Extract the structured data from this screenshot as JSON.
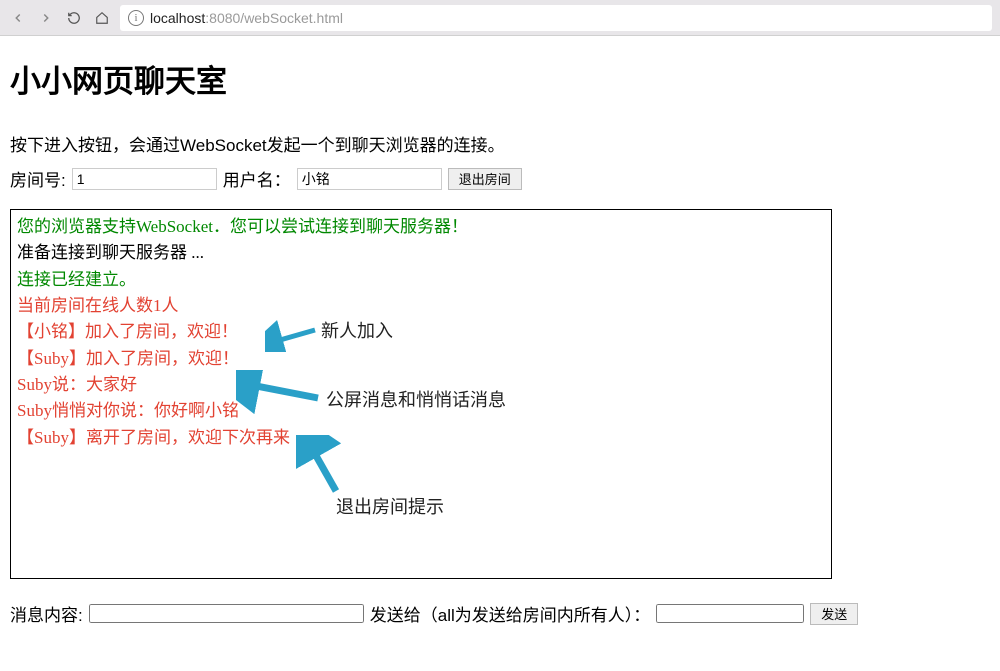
{
  "browser": {
    "url_host": "localhost",
    "url_port_path": ":8080/webSocket.html"
  },
  "page": {
    "title": "小小网页聊天室",
    "description": "按下进入按钮，会通过WebSocket发起一个到聊天浏览器的连接。"
  },
  "form": {
    "room_label": "房间号:",
    "room_value": "1",
    "user_label": "用户名：",
    "user_value": "小铭",
    "exit_button": "退出房间"
  },
  "messages": {
    "support": "您的浏览器支持WebSocket．您可以尝试连接到聊天服务器！",
    "preparing": "准备连接到聊天服务器 ...",
    "established": "连接已经建立。",
    "online_count": "当前房间在线人数1人",
    "join1": "【小铭】加入了房间，欢迎！",
    "join2": "【Suby】加入了房间，欢迎！",
    "say": "Suby说：大家好",
    "whisper": "Suby悄悄对你说：你好啊小铭",
    "leave": "【Suby】离开了房间，欢迎下次再来"
  },
  "annotations": {
    "new_join": "新人加入",
    "public_private": "公屏消息和悄悄话消息",
    "exit_notice": "退出房间提示"
  },
  "bottom": {
    "msg_label": "消息内容:",
    "send_to_label": "发送给（all为发送给房间内所有人）：",
    "send_button": "发送"
  },
  "colors": {
    "arrow": "#2aa0c8"
  }
}
